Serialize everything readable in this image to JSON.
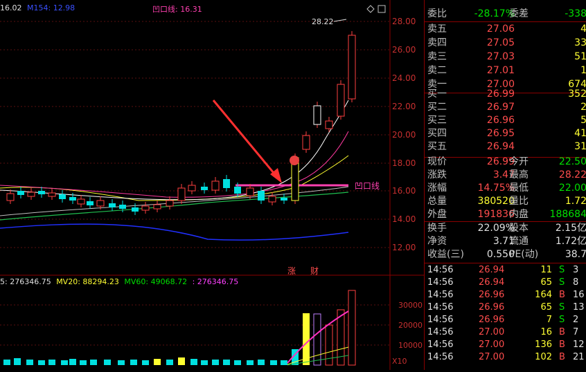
{
  "chart": {
    "legend_ma": [
      "16.02",
      "M154: 12.98"
    ],
    "indicator_label": "凹口线: 16.31",
    "high_marker": "28.22",
    "price_ticks": [
      "28.00",
      "26.00",
      "24.00",
      "22.00",
      "20.00",
      "18.00",
      "16.00",
      "14.00",
      "12.00"
    ],
    "line_label": "凹口线",
    "badge_zhang": "涨",
    "badge_cai": "财",
    "vol_legend": [
      "5: 276346.75",
      "MV20: 88294.23",
      "MV60: 49068.72",
      ": 276346.75"
    ],
    "vol_ticks": [
      "30000",
      "20000",
      "10000"
    ],
    "unit": "X10"
  },
  "quote": {
    "header": {
      "weibi_label": "委比",
      "weibi": "-28.17%",
      "weicha_label": "委差",
      "weicha": "-338"
    },
    "asks": [
      {
        "label": "卖五",
        "price": "27.06",
        "vol": "4"
      },
      {
        "label": "卖四",
        "price": "27.05",
        "vol": "33"
      },
      {
        "label": "卖三",
        "price": "27.03",
        "vol": "51"
      },
      {
        "label": "卖二",
        "price": "27.01",
        "vol": "1"
      },
      {
        "label": "卖一",
        "price": "27.00",
        "vol": "674"
      }
    ],
    "bids": [
      {
        "label": "买一",
        "price": "26.99",
        "vol": "352"
      },
      {
        "label": "买二",
        "price": "26.97",
        "vol": "2"
      },
      {
        "label": "买三",
        "price": "26.96",
        "vol": "5"
      },
      {
        "label": "买四",
        "price": "26.95",
        "vol": "41"
      },
      {
        "label": "买五",
        "price": "26.94",
        "vol": "31"
      }
    ],
    "stats": [
      {
        "l1": "现价",
        "v1": "26.99",
        "l2": "今开",
        "v2": "22.50"
      },
      {
        "l1": "涨跌",
        "v1": "3.47",
        "l2": "最高",
        "v2": "28.22"
      },
      {
        "l1": "涨幅",
        "v1": "14.75%",
        "l2": "最低",
        "v2": "22.00"
      },
      {
        "l1": "总量",
        "v1": "380520",
        "l2": "量比",
        "v2": "1.72"
      },
      {
        "l1": "外盘",
        "v1": "191836",
        "l2": "内盘",
        "v2": "188684"
      }
    ],
    "fund": [
      {
        "l1": "换手",
        "v1": "22.09%",
        "l2": "股本",
        "v2": "2.15亿"
      },
      {
        "l1": "净资",
        "v1": "3.71",
        "l2": "流通",
        "v2": "1.72亿"
      },
      {
        "l1": "收益(三)",
        "v1": "0.550",
        "l2": "PE(动)",
        "v2": "38.7"
      }
    ],
    "ticks": [
      {
        "time": "14:56",
        "price": "26.94",
        "qty": "11",
        "side": "S",
        "n": "3"
      },
      {
        "time": "14:56",
        "price": "26.94",
        "qty": "65",
        "side": "S",
        "n": "8"
      },
      {
        "time": "14:56",
        "price": "26.96",
        "qty": "164",
        "side": "B",
        "n": "16"
      },
      {
        "time": "14:56",
        "price": "26.96",
        "qty": "65",
        "side": "S",
        "n": "13"
      },
      {
        "time": "14:56",
        "price": "26.96",
        "qty": "7",
        "side": "S",
        "n": "2"
      },
      {
        "time": "14:56",
        "price": "27.00",
        "qty": "16",
        "side": "B",
        "n": "7"
      },
      {
        "time": "14:56",
        "price": "27.00",
        "qty": "136",
        "side": "B",
        "n": "12"
      },
      {
        "time": "14:56",
        "price": "27.00",
        "qty": "102",
        "side": "B",
        "n": "21"
      }
    ]
  }
}
